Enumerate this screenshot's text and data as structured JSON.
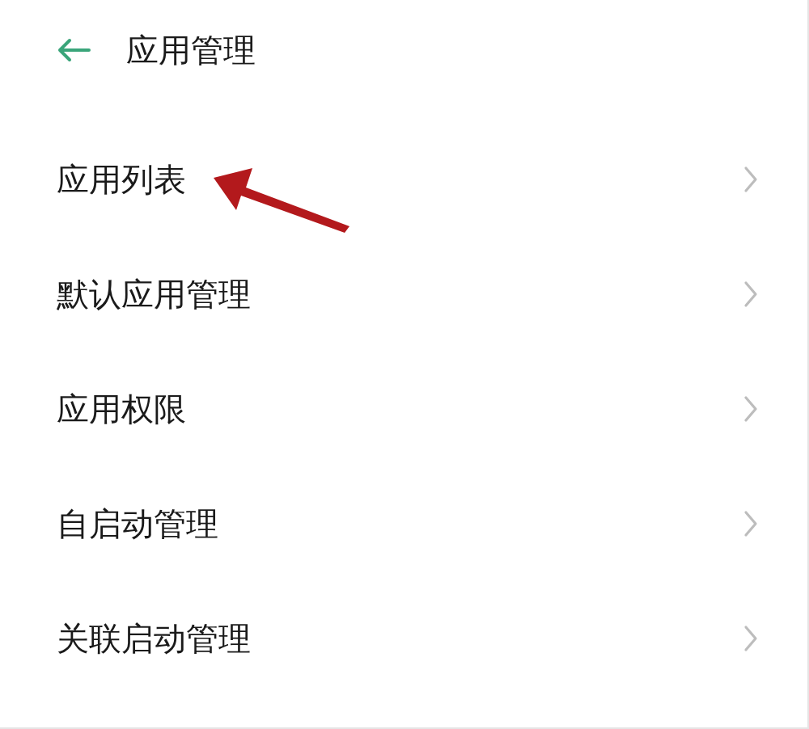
{
  "header": {
    "title": "应用管理"
  },
  "items": [
    {
      "label": "应用列表"
    },
    {
      "label": "默认应用管理"
    },
    {
      "label": "应用权限"
    },
    {
      "label": "自启动管理"
    },
    {
      "label": "关联启动管理"
    }
  ]
}
